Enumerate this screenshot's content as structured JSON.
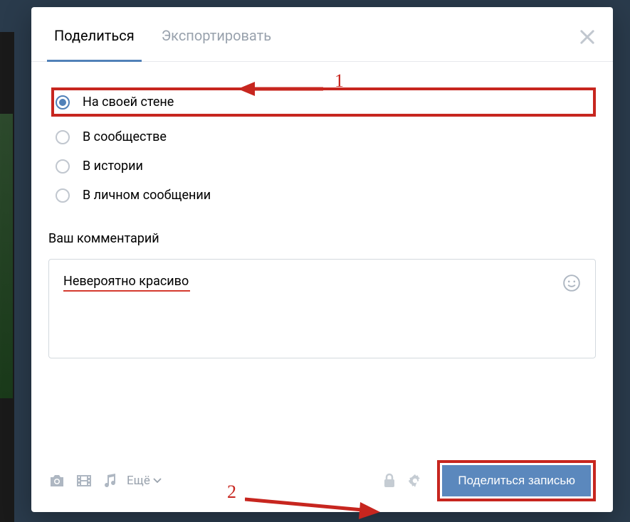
{
  "tabs": {
    "share": "Поделиться",
    "export": "Экспортировать"
  },
  "options": {
    "own_wall": "На своей стене",
    "community": "В сообществе",
    "story": "В истории",
    "private_msg": "В личном сообщении"
  },
  "comment_label": "Ваш комментарий",
  "comment_text": "Невероятно красиво",
  "more_label": "Ещё",
  "share_button": "Поделиться записью",
  "annotations": {
    "step1": "1",
    "step2": "2"
  }
}
